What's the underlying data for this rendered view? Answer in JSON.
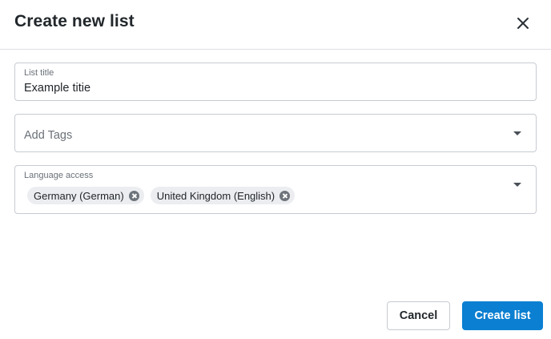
{
  "dialog": {
    "title": "Create new list",
    "close_icon": "close-icon"
  },
  "fields": {
    "list_title": {
      "label": "List title",
      "value": "Example titie"
    },
    "tags": {
      "placeholder": "Add Tags",
      "icon": "dropdown-arrow-icon"
    },
    "language_access": {
      "label": "Language access",
      "chips": [
        {
          "label": "Germany (German)",
          "remove_icon": "remove-chip-icon"
        },
        {
          "label": "United Kingdom (English)",
          "remove_icon": "remove-chip-icon"
        }
      ],
      "icon": "dropdown-arrow-icon"
    }
  },
  "actions": {
    "cancel_label": "Cancel",
    "create_label": "Create list"
  },
  "colors": {
    "primary": "#0b7fd1",
    "border": "#c7cbd1",
    "chip_bg": "#ebedf0",
    "label_text": "#6b7178"
  }
}
